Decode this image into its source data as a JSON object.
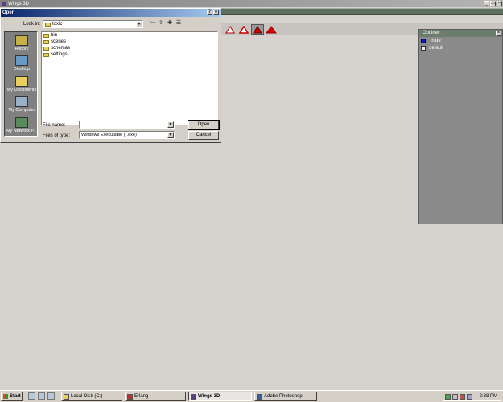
{
  "app": {
    "title": "Wings 3D",
    "min_glyph": "_",
    "max_glyph": "□",
    "close_glyph": "×"
  },
  "toolbar": {
    "modes": [
      "vertex-mode",
      "edge-mode",
      "face-mode",
      "body-mode"
    ]
  },
  "outliner": {
    "title": "Outliner",
    "close_glyph": "×",
    "items": [
      {
        "label": "_hide_",
        "icon": "hidden-object-icon"
      },
      {
        "label": "default",
        "icon": "layer-icon"
      }
    ]
  },
  "dialog": {
    "title": "Open",
    "help_glyph": "?",
    "close_glyph": "×",
    "look_in_label": "Look in:",
    "look_in_value": "toxic",
    "places": [
      {
        "label": "History",
        "icon": "history-icon"
      },
      {
        "label": "Desktop",
        "icon": "desktop-icon"
      },
      {
        "label": "My Documents",
        "icon": "my-documents-icon"
      },
      {
        "label": "My Computer",
        "icon": "my-computer-icon"
      },
      {
        "label": "My Network P...",
        "icon": "my-network-icon"
      }
    ],
    "files": [
      "bin",
      "scenes",
      "schemas",
      "settings"
    ],
    "file_name_label": "File name:",
    "file_name_value": "",
    "files_of_type_label": "Files of type:",
    "files_of_type_value": "Windows Executable (*.exe)",
    "open_button": "Open",
    "cancel_button": "Cancel"
  },
  "taskbar": {
    "start_label": "Start",
    "tasks": [
      {
        "label": "Local Disk (C:)",
        "pressed": false
      },
      {
        "label": "Erlang",
        "pressed": false
      },
      {
        "label": "Wings 3D",
        "pressed": true
      },
      {
        "label": "Adobe Photoshop",
        "pressed": false
      }
    ],
    "clock": "2:38 PM"
  }
}
